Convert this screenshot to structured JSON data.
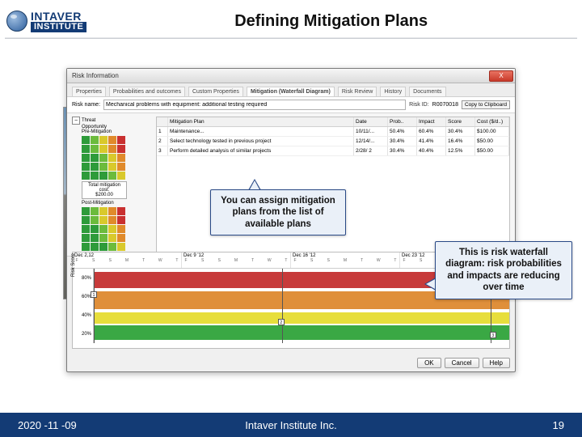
{
  "slide": {
    "title": "Defining Mitigation Plans",
    "logo": {
      "top": "INTAVER",
      "bottom": "INSTITUTE"
    },
    "footer": {
      "date": "2020 -11 -09",
      "org": "Intaver Institute Inc.",
      "page": "19"
    }
  },
  "dialog": {
    "title": "Risk Information",
    "close": "X",
    "tabs": [
      "Properties",
      "Probabilities and outcomes",
      "Custom Properties",
      "Mitigation (Waterfall Diagram)",
      "Risk Review",
      "History",
      "Documents"
    ],
    "active_tab": 3,
    "risk_name_label": "Risk name:",
    "risk_name_value": "Mechanical problems with equipment: additional testing required",
    "risk_id_label": "Risk ID:",
    "risk_id_value": "R0070018",
    "copy_btn": "Copy to Clipboard",
    "matrix": {
      "rows": [
        "Threat",
        "Opportunity",
        "Pre-Mitigation"
      ],
      "total_label": "Total mitigation cost:",
      "total_value": "$200.00",
      "post_label": "Post-Mitigation"
    },
    "plan": {
      "title": "Mitigation Plan",
      "cols": [
        "",
        "Mitigation Plan",
        "Date",
        "Prob..",
        "Impact",
        "Score",
        "Cost ($/d..)"
      ],
      "rows": [
        [
          "1",
          "Maintenance...",
          "10/11/...",
          "50.4%",
          "60.4%",
          "30.4%",
          "$100.00"
        ],
        [
          "2",
          "Select technology tested in previous project",
          "12/14/...",
          "30.4%",
          "41.4%",
          "16.4%",
          "$50.00"
        ],
        [
          "3",
          "Perform detailed analysis of similar projects",
          "2/28/ 2",
          "30.4%",
          "40.4%",
          "12.5%",
          "$50.00"
        ]
      ]
    },
    "gantt": {
      "months": [
        "Dec 2,12",
        "Dec 9 '12",
        "Dec 16 '12",
        "Dec 23 '12"
      ],
      "days": [
        "F",
        "S",
        "S",
        "M",
        "T",
        "W",
        "T"
      ],
      "pct": [
        "80%",
        "60%",
        "40%",
        "20%"
      ],
      "ylabel": "Risk Score",
      "markers": [
        "1",
        "2",
        "3"
      ]
    },
    "buttons": {
      "ok": "OK",
      "cancel": "Cancel",
      "help": "Help"
    }
  },
  "callouts": {
    "c1": "You can assign mitigation plans from the list of available plans",
    "c2": "This is risk waterfall diagram: risk probabilities and impacts are reducing over time"
  }
}
